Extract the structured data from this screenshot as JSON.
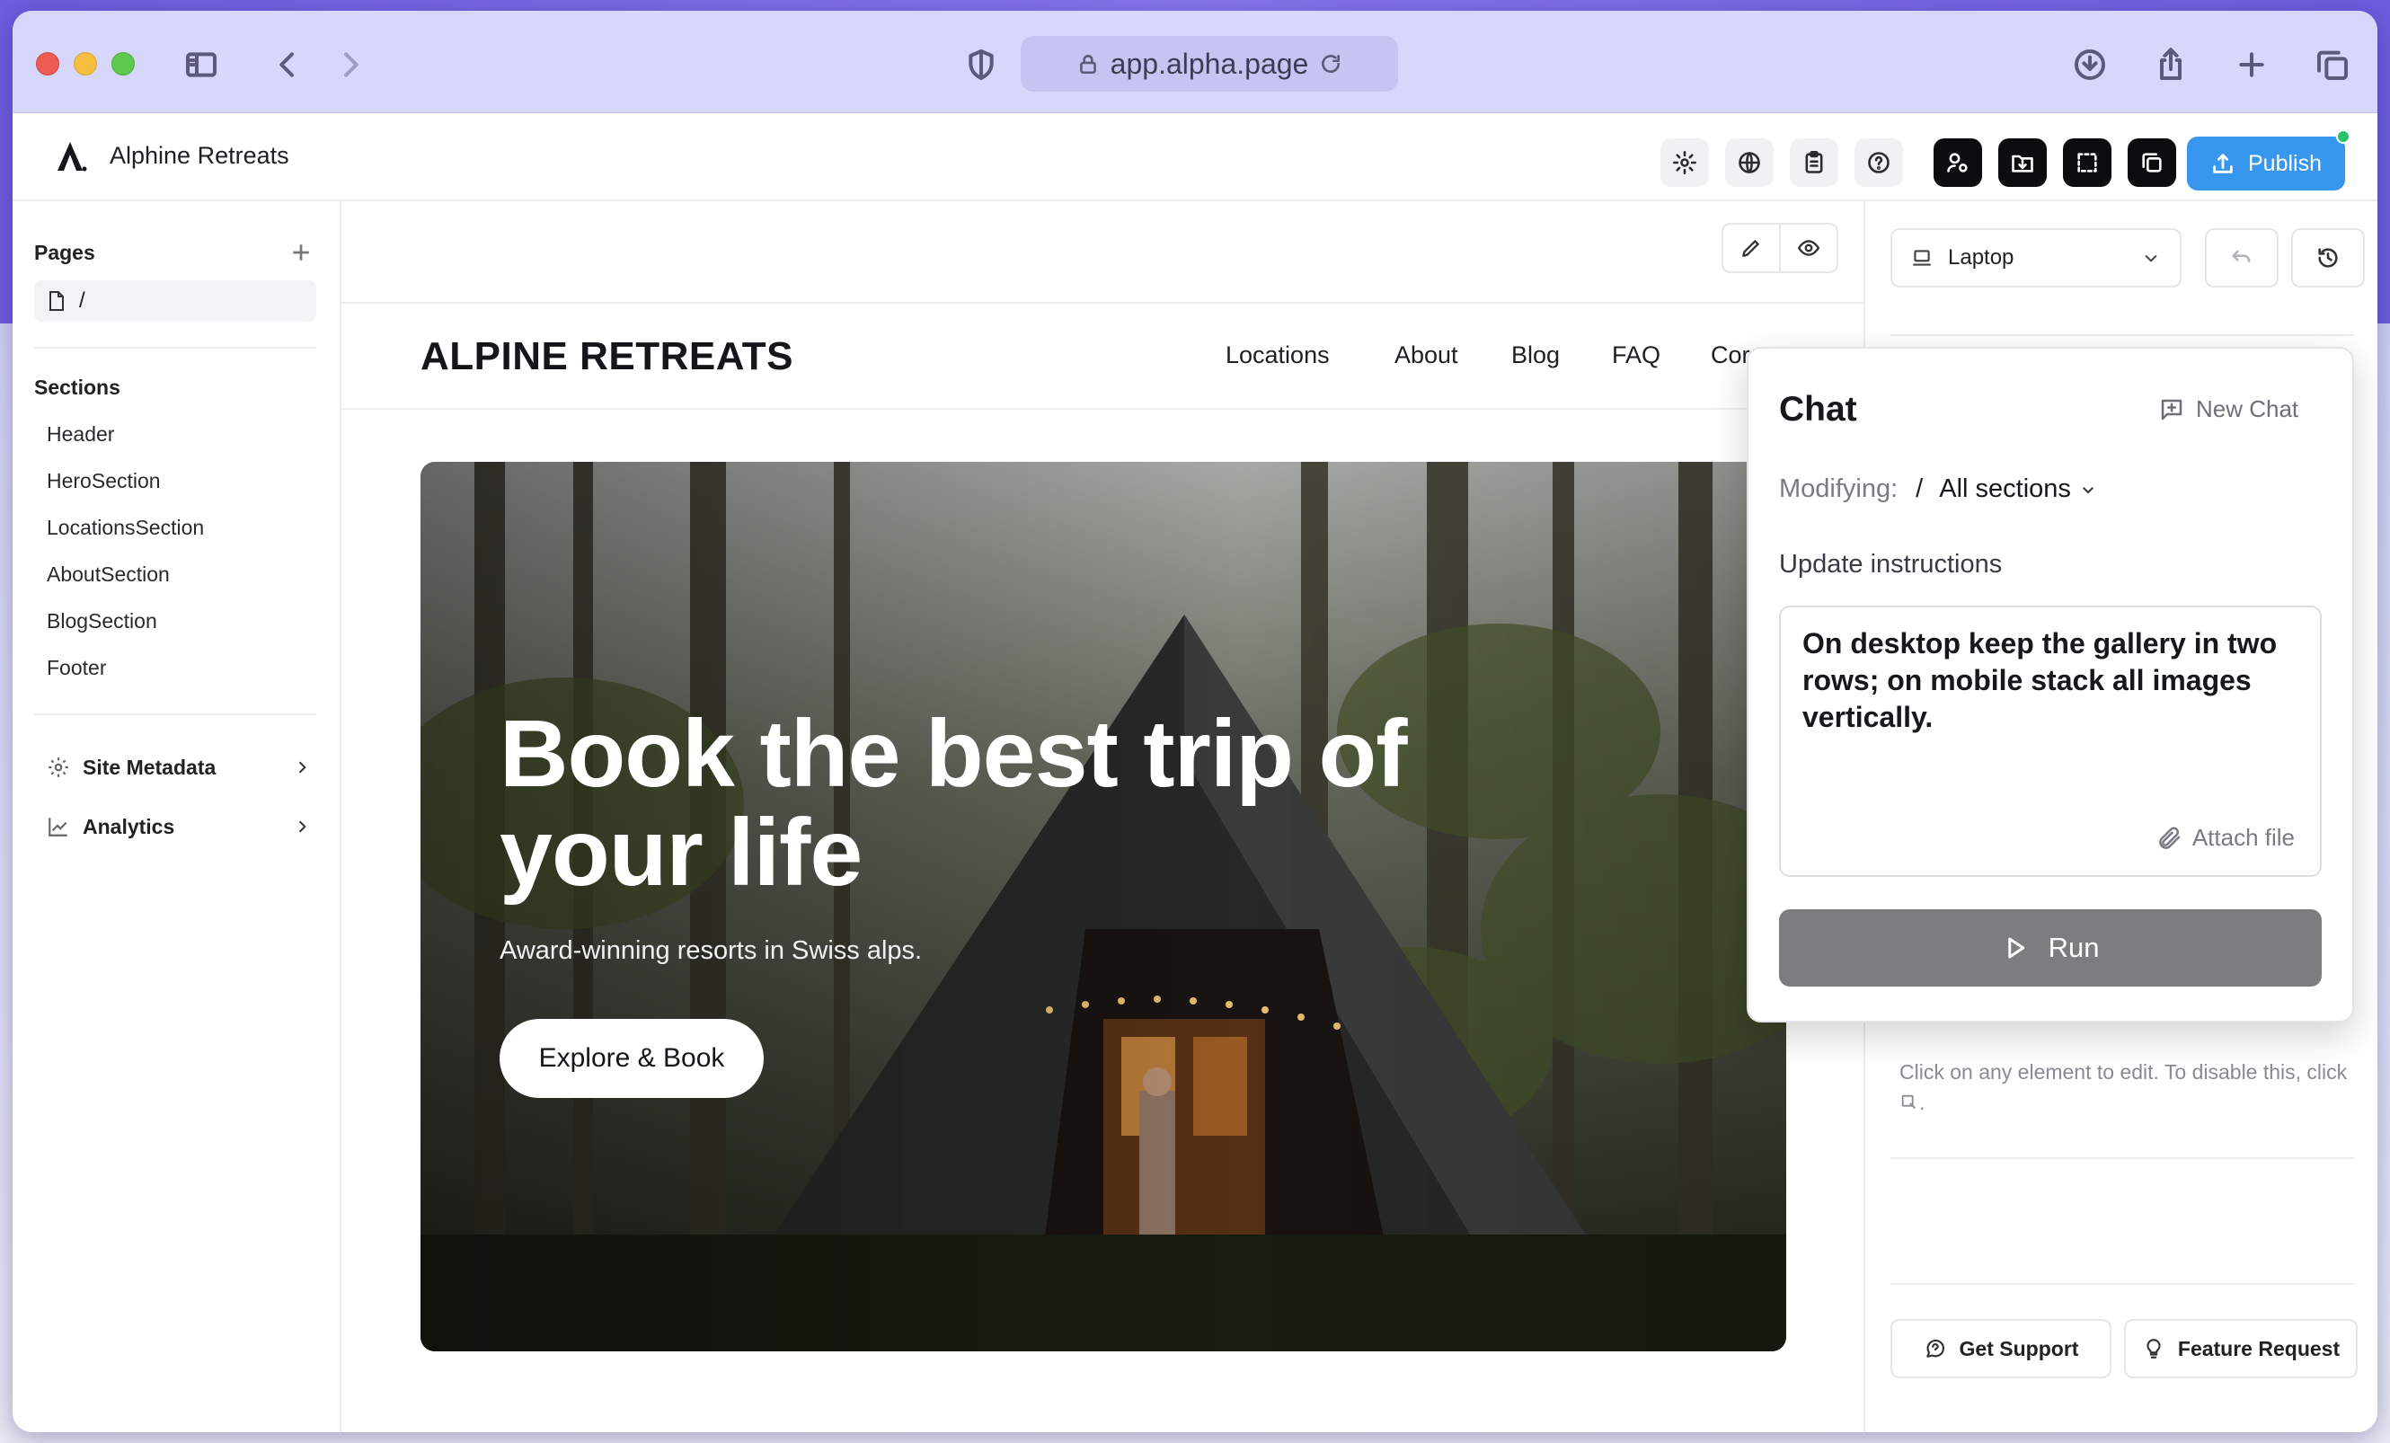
{
  "browser": {
    "url": "app.alpha.page"
  },
  "app": {
    "title": "Alphine Retreats",
    "publish_label": "Publish",
    "accent_color": "#3797ef"
  },
  "sidebar": {
    "pages_heading": "Pages",
    "pages": [
      "/"
    ],
    "sections_heading": "Sections",
    "sections": [
      "Header",
      "HeroSection",
      "LocationsSection",
      "AboutSection",
      "BlogSection",
      "Footer"
    ],
    "links": [
      {
        "label": "Site Metadata",
        "icon": "gear-icon"
      },
      {
        "label": "Analytics",
        "icon": "chart-line-icon"
      }
    ]
  },
  "site": {
    "brand": "ALPINE RETREATS",
    "nav": [
      "Locations",
      "About",
      "Blog",
      "FAQ",
      "Cor"
    ],
    "hero_title": "Book the best trip of your life",
    "hero_subtitle": "Award-winning resorts in Swiss alps.",
    "hero_button": "Explore & Book"
  },
  "right_panel": {
    "device": "Laptop",
    "hint": "Click on any element to edit. To disable this, click",
    "get_support": "Get Support",
    "feature_request": "Feature Request"
  },
  "chat": {
    "title": "Chat",
    "new_chat": "New Chat",
    "modifying_label": "Modifying:",
    "modifying_path": "/",
    "modifying_value": "All sections",
    "instructions_label": "Update instructions",
    "instructions_value": "On desktop keep the gallery in two rows; on mobile stack all images vertically.",
    "attach_label": "Attach file",
    "run_label": "Run"
  }
}
